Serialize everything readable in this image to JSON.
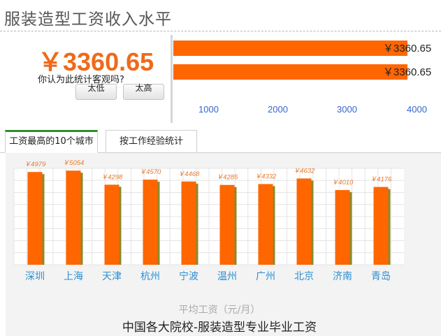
{
  "page_title": "服装造型工资收入水平",
  "summary": {
    "salary_display": "￥3360.65",
    "question": "你认为此统计客观吗?",
    "btn_low": "太低",
    "btn_high": "太高"
  },
  "comparison": {
    "bars": [
      {
        "value": 3360.65,
        "label": "￥3360.65"
      },
      {
        "value": 3360.65,
        "label": "￥3360.65"
      }
    ],
    "axis_ticks": [
      "1000",
      "2000",
      "3000",
      "4000"
    ],
    "axis_max": 4400,
    "bar_color": "#ff6600"
  },
  "tabs": {
    "active": "工资最高的10个城市",
    "inactive": "按工作经验统计"
  },
  "chart_data": {
    "type": "bar",
    "categories": [
      "深圳",
      "上海",
      "天津",
      "杭州",
      "宁波",
      "温州",
      "广州",
      "北京",
      "济南",
      "青岛"
    ],
    "values": [
      4979,
      5054,
      4298,
      4570,
      4468,
      4285,
      4332,
      4632,
      4010,
      4176
    ],
    "value_labels": [
      "￥4979",
      "￥5054",
      "￥4298",
      "￥4570",
      "￥4468",
      "￥4285",
      "￥4332",
      "￥4632",
      "￥4010",
      "￥4176"
    ],
    "xlabel": "平均工资（元/月）",
    "title": "中国各大院校-服装造型专业毕业工资",
    "ylim": [
      0,
      6000
    ],
    "grid": true,
    "bar_color": "#ff6600",
    "shadow_color": "#8a8a2a"
  }
}
